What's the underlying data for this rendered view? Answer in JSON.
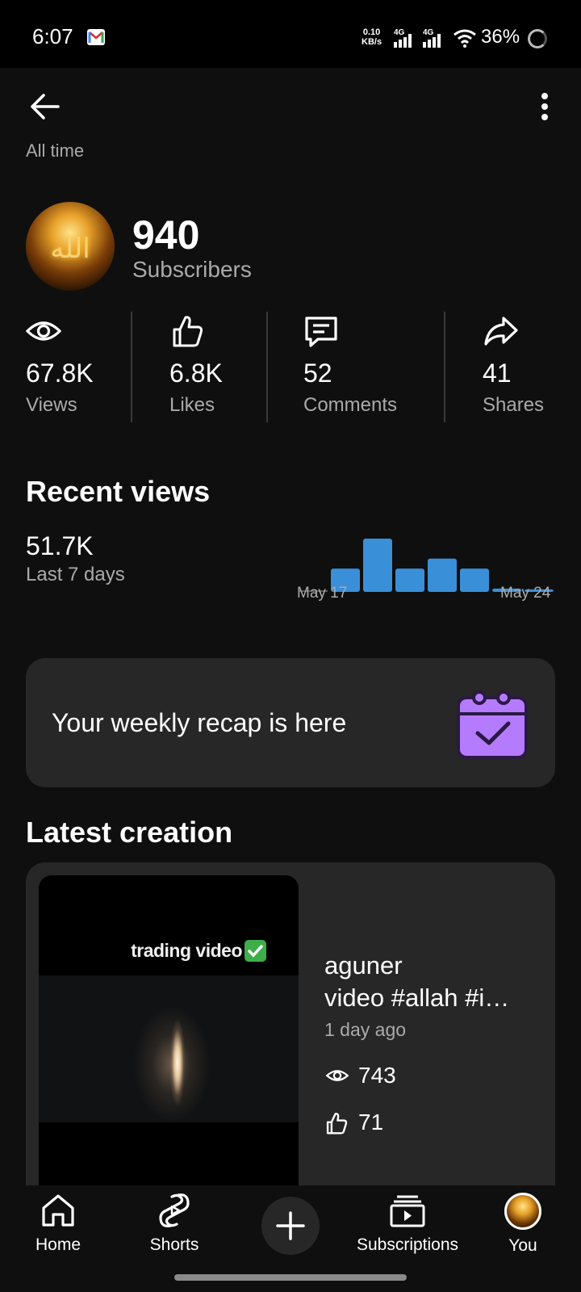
{
  "status_bar": {
    "time": "6:07",
    "net_speed_top": "0.10",
    "net_speed_bottom": "KB/s",
    "sim1": "4G",
    "sim2": "4G",
    "battery": "36%"
  },
  "header": {
    "period": "All time"
  },
  "channel": {
    "subscribers": "940",
    "subscribers_label": "Subscribers"
  },
  "metrics": [
    {
      "icon": "eye-icon",
      "value": "67.8K",
      "label": "Views"
    },
    {
      "icon": "thumbs-up-icon",
      "value": "6.8K",
      "label": "Likes"
    },
    {
      "icon": "comment-icon",
      "value": "52",
      "label": "Comments"
    },
    {
      "icon": "share-icon",
      "value": "41",
      "label": "Shares"
    }
  ],
  "recent_views": {
    "title": "Recent views",
    "value": "51.7K",
    "subtitle": "Last 7 days",
    "chart_data": {
      "type": "bar",
      "x_start": "May 17",
      "x_end": "May 24",
      "values": [
        0,
        28,
        64,
        28,
        40,
        28,
        4,
        3
      ],
      "bar_color": "#3a8fd9",
      "empty_color": "#555555"
    }
  },
  "recap": {
    "text": "Your weekly recap is here",
    "icon": "calendar-check-icon",
    "icon_color": "#b57bff"
  },
  "latest_creation": {
    "title": "Latest creation",
    "thumbnail_text": "trading video",
    "video_title_line1": "aguner",
    "video_title_line2": "video #allah #i…",
    "age": "1 day ago",
    "views": "743",
    "likes": "71"
  },
  "nav": {
    "home": "Home",
    "shorts": "Shorts",
    "subscriptions": "Subscriptions",
    "you": "You"
  }
}
